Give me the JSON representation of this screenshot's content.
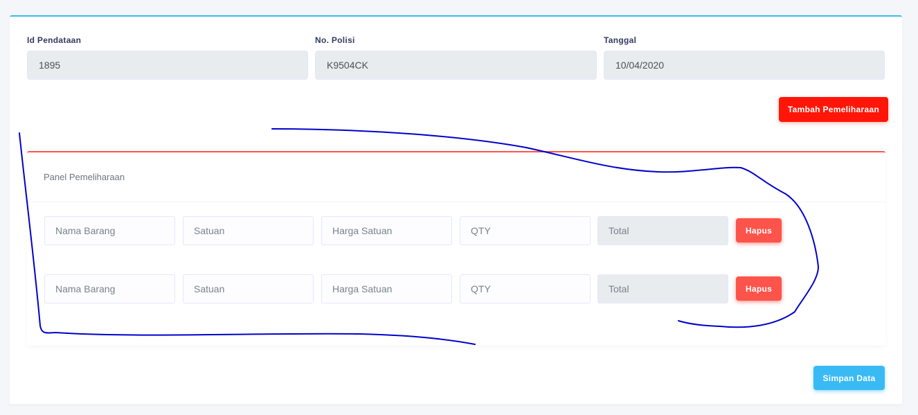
{
  "header_fields": [
    {
      "label": "Id Pendataan",
      "value": "1895"
    },
    {
      "label": "No. Polisi",
      "value": "K9504CK"
    },
    {
      "label": "Tanggal",
      "value": "10/04/2020"
    }
  ],
  "actions": {
    "add_label": "Tambah Pemeliharaan",
    "save_label": "Simpan Data"
  },
  "panel": {
    "title": "Panel Pemeliharaan",
    "rows": [
      {
        "nama_placeholder": "Nama Barang",
        "satuan_placeholder": "Satuan",
        "harga_placeholder": "Harga Satuan",
        "qty_placeholder": "QTY",
        "total_placeholder": "Total",
        "delete_label": "Hapus"
      },
      {
        "nama_placeholder": "Nama Barang",
        "satuan_placeholder": "Satuan",
        "harga_placeholder": "Harga Satuan",
        "qty_placeholder": "QTY",
        "total_placeholder": "Total",
        "delete_label": "Hapus"
      }
    ]
  },
  "colors": {
    "accent_top": "#3abaf4",
    "add_button": "#ff1608",
    "delete_button": "#fc544b",
    "save_button": "#3abaf4",
    "annotation": "#0000cc"
  }
}
